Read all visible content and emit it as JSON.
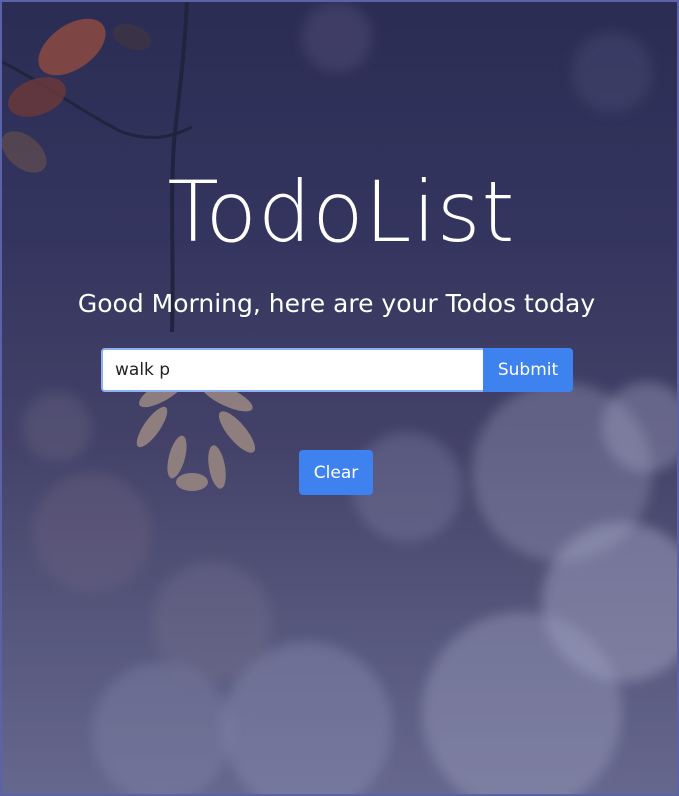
{
  "app": {
    "title": "TodoList",
    "greeting": "Good Morning, here are your Todos today"
  },
  "todo_form": {
    "input_value": "walk p",
    "submit_label": "Submit"
  },
  "actions": {
    "clear_label": "Clear"
  },
  "colors": {
    "accent": "#3e82f0",
    "text": "#ffffff",
    "frame_border": "#5a63a8"
  },
  "icons": {
    "background": "bokeh-leaves-photo"
  }
}
